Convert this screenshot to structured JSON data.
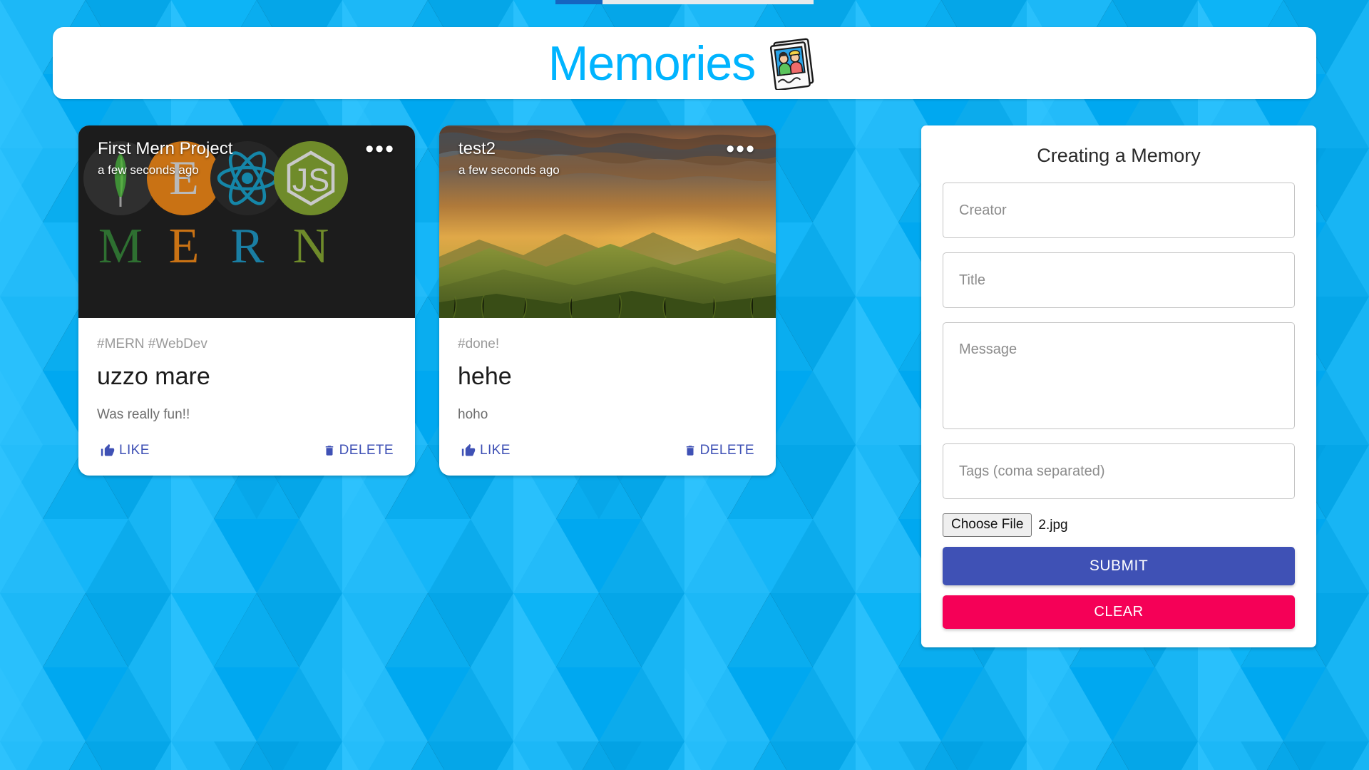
{
  "header": {
    "title": "Memories",
    "icon": "photos-icon"
  },
  "topbar": {
    "segment_a_color": "#1565c0",
    "segment_b_color": "#e8eaec"
  },
  "theme": {
    "background_blue": "#12b0f0",
    "title_blue": "#00b4ff",
    "primary": "#3f51b5",
    "secondary": "#f50057"
  },
  "posts": [
    {
      "creator": "First Mern Project",
      "time": "a few seconds ago",
      "menu": "•••",
      "tags": "#MERN #WebDev",
      "title": "uzzo mare",
      "message": "Was really fun!!",
      "like_label": "LIKE",
      "delete_label": "DELETE",
      "image_kind": "mern-stack-logo"
    },
    {
      "creator": "test2",
      "time": "a few seconds ago",
      "menu": "•••",
      "tags": "#done!",
      "title": "hehe",
      "message": "hoho",
      "like_label": "LIKE",
      "delete_label": "DELETE",
      "image_kind": "sunset-landscape"
    }
  ],
  "form": {
    "heading": "Creating a Memory",
    "creator_placeholder": "Creator",
    "creator_value": "",
    "title_placeholder": "Title",
    "title_value": "",
    "message_placeholder": "Message",
    "message_value": "",
    "tags_placeholder": "Tags (coma separated)",
    "tags_value": "",
    "file_button_label": "Choose File",
    "file_name": "2.jpg",
    "submit_label": "SUBMIT",
    "clear_label": "CLEAR"
  },
  "mern_image": {
    "letters": [
      "M",
      "E",
      "R",
      "N"
    ],
    "letter_colors": [
      "#2e7031",
      "#c97214",
      "#1a7ea3",
      "#6f8b2a"
    ],
    "background": "#1c1c1c",
    "express_letter": "E",
    "node_letter": "JS"
  }
}
